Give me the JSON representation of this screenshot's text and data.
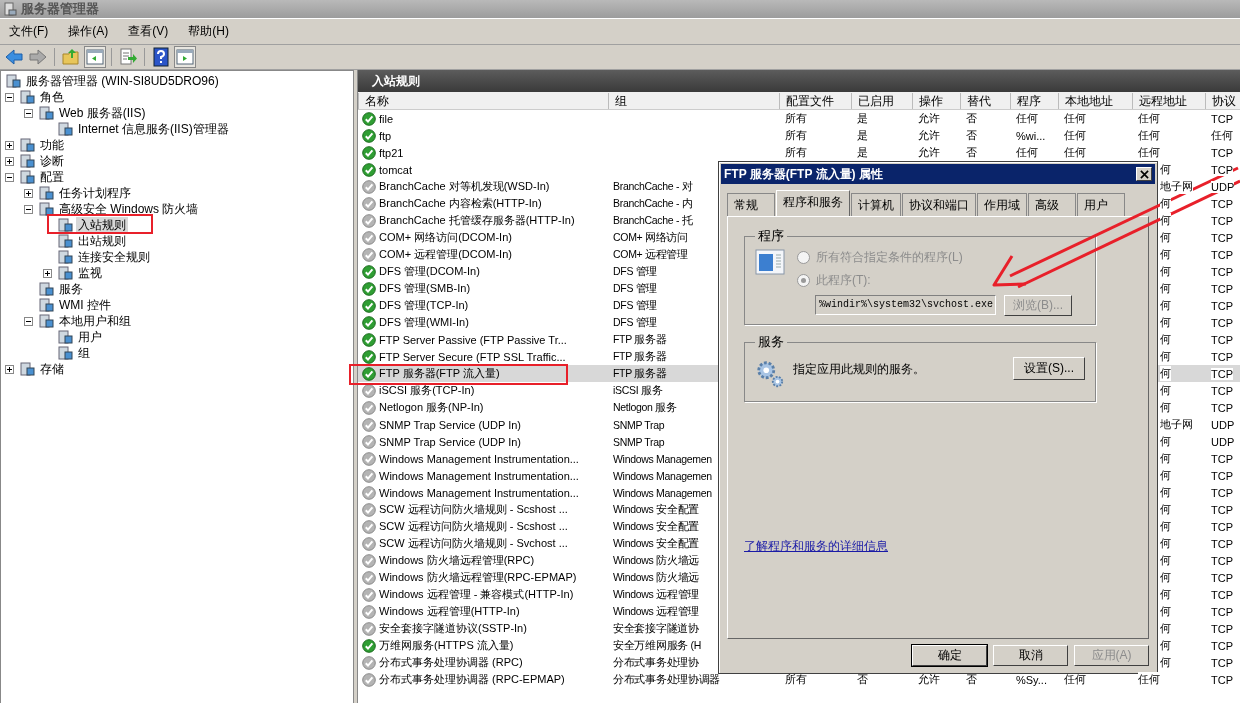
{
  "window": {
    "title": "服务器管理器"
  },
  "menu": [
    "文件(F)",
    "操作(A)",
    "查看(V)",
    "帮助(H)"
  ],
  "tree": {
    "label": "服务器管理器 (WIN-SI8UD5DRO96)",
    "selected": false,
    "children": [
      {
        "label": "角色",
        "selected": false,
        "expanded": true,
        "children": [
          {
            "label": "Web 服务器(IIS)",
            "selected": false,
            "expanded": true,
            "children": [
              {
                "label": "Internet 信息服务(IIS)管理器",
                "selected": false
              }
            ]
          }
        ]
      },
      {
        "label": "功能",
        "selected": false,
        "expanded": false
      },
      {
        "label": "诊断",
        "selected": false,
        "expanded": false
      },
      {
        "label": "配置",
        "selected": false,
        "expanded": true,
        "children": [
          {
            "label": "任务计划程序",
            "selected": false,
            "expanded": false
          },
          {
            "label": "高级安全 Windows 防火墙",
            "selected": false,
            "expanded": true,
            "children": [
              {
                "label": "入站规则",
                "selected": true
              },
              {
                "label": "出站规则",
                "selected": false
              },
              {
                "label": "连接安全规则",
                "selected": false
              },
              {
                "label": "监视",
                "selected": false,
                "expanded": false
              }
            ]
          },
          {
            "label": "服务",
            "selected": false
          },
          {
            "label": "WMI 控件",
            "selected": false
          },
          {
            "label": "本地用户和组",
            "selected": false,
            "expanded": true,
            "children": [
              {
                "label": "用户",
                "selected": false
              },
              {
                "label": "组",
                "selected": false
              }
            ]
          }
        ]
      },
      {
        "label": "存储",
        "selected": false,
        "expanded": false
      }
    ]
  },
  "pane": {
    "title": "入站规则",
    "columns": [
      "名称",
      "组",
      "配置文件",
      "已启用",
      "操作",
      "替代",
      "程序",
      "本地地址",
      "远程地址",
      "协议"
    ],
    "rows": [
      {
        "name": "file",
        "enabled": true,
        "selected": false,
        "profile": "所有",
        "on": "是",
        "action": "允许",
        "override": "否",
        "program": "任何",
        "local": "任何",
        "remote": "任何",
        "protocol": "TCP"
      },
      {
        "name": "ftp",
        "enabled": true,
        "selected": false,
        "profile": "所有",
        "on": "是",
        "action": "允许",
        "override": "否",
        "program": "%wi...",
        "local": "任何",
        "remote": "任何",
        "protocol": "任何"
      },
      {
        "name": "ftp21",
        "enabled": true,
        "selected": false,
        "profile": "所有",
        "on": "是",
        "action": "允许",
        "override": "否",
        "program": "任何",
        "local": "任何",
        "remote": "任何",
        "protocol": "TCP"
      },
      {
        "name": "tomcat",
        "enabled": true,
        "selected": false,
        "remote": "何",
        "protocol": "TCP"
      },
      {
        "name": "BranchCache 对等机发现(WSD-In)",
        "enabled": false,
        "selected": false,
        "group": "BranchCache - 对",
        "remote": "地子网",
        "protocol": "UDP"
      },
      {
        "name": "BranchCache 内容检索(HTTP-In)",
        "enabled": false,
        "selected": false,
        "group": "BranchCache - 内",
        "remote": "何",
        "protocol": "TCP"
      },
      {
        "name": "BranchCache 托管缓存服务器(HTTP-In)",
        "enabled": false,
        "selected": false,
        "group": "BranchCache - 托",
        "remote": "何",
        "protocol": "TCP"
      },
      {
        "name": "COM+ 网络访问(DCOM-In)",
        "enabled": false,
        "selected": false,
        "group": "COM+ 网络访问",
        "remote": "何",
        "protocol": "TCP"
      },
      {
        "name": "COM+ 远程管理(DCOM-In)",
        "enabled": false,
        "selected": false,
        "group": "COM+ 远程管理",
        "remote": "何",
        "protocol": "TCP"
      },
      {
        "name": "DFS 管理(DCOM-In)",
        "enabled": true,
        "selected": false,
        "group": "DFS 管理",
        "remote": "何",
        "protocol": "TCP"
      },
      {
        "name": "DFS 管理(SMB-In)",
        "enabled": true,
        "selected": false,
        "group": "DFS 管理",
        "remote": "何",
        "protocol": "TCP"
      },
      {
        "name": "DFS 管理(TCP-In)",
        "enabled": true,
        "selected": false,
        "group": "DFS 管理",
        "remote": "何",
        "protocol": "TCP"
      },
      {
        "name": "DFS 管理(WMI-In)",
        "enabled": true,
        "selected": false,
        "group": "DFS 管理",
        "remote": "何",
        "protocol": "TCP"
      },
      {
        "name": "FTP Server Passive (FTP Passive Tr...",
        "enabled": true,
        "selected": false,
        "group": "FTP 服务器",
        "remote": "何",
        "protocol": "TCP"
      },
      {
        "name": "FTP Server Secure (FTP SSL Traffic...",
        "enabled": true,
        "selected": false,
        "group": "FTP 服务器",
        "remote": "何",
        "protocol": "TCP"
      },
      {
        "name": "FTP 服务器(FTP 流入量)",
        "enabled": true,
        "selected": true,
        "group": "FTP 服务器",
        "remote": "何",
        "protocol": "TCP"
      },
      {
        "name": "iSCSI 服务(TCP-In)",
        "enabled": false,
        "selected": false,
        "group": "iSCSI 服务",
        "remote": "何",
        "protocol": "TCP"
      },
      {
        "name": "Netlogon 服务(NP-In)",
        "enabled": false,
        "selected": false,
        "group": "Netlogon 服务",
        "remote": "何",
        "protocol": "TCP"
      },
      {
        "name": "SNMP Trap Service (UDP In)",
        "enabled": false,
        "selected": false,
        "group": "SNMP Trap",
        "remote": "地子网",
        "protocol": "UDP"
      },
      {
        "name": "SNMP Trap Service (UDP In)",
        "enabled": false,
        "selected": false,
        "group": "SNMP Trap",
        "remote": "何",
        "protocol": "UDP"
      },
      {
        "name": "Windows Management Instrumentation...",
        "enabled": false,
        "selected": false,
        "group": "Windows Managemen",
        "remote": "何",
        "protocol": "TCP"
      },
      {
        "name": "Windows Management Instrumentation...",
        "enabled": false,
        "selected": false,
        "group": "Windows Managemen",
        "remote": "何",
        "protocol": "TCP"
      },
      {
        "name": "Windows Management Instrumentation...",
        "enabled": false,
        "selected": false,
        "group": "Windows Managemen",
        "remote": "何",
        "protocol": "TCP"
      },
      {
        "name": "SCW 远程访问防火墙规则 - Scshost ...",
        "enabled": false,
        "selected": false,
        "group": "Windows 安全配置",
        "remote": "何",
        "protocol": "TCP"
      },
      {
        "name": "SCW 远程访问防火墙规则 - Scshost ...",
        "enabled": false,
        "selected": false,
        "group": "Windows 安全配置",
        "remote": "何",
        "protocol": "TCP"
      },
      {
        "name": "SCW 远程访问防火墙规则 - Svchost ...",
        "enabled": false,
        "selected": false,
        "group": "Windows 安全配置",
        "remote": "何",
        "protocol": "TCP"
      },
      {
        "name": "Windows 防火墙远程管理(RPC)",
        "enabled": false,
        "selected": false,
        "group": "Windows 防火墙远",
        "remote": "何",
        "protocol": "TCP"
      },
      {
        "name": "Windows 防火墙远程管理(RPC-EPMAP)",
        "enabled": false,
        "selected": false,
        "group": "Windows 防火墙远",
        "remote": "何",
        "protocol": "TCP"
      },
      {
        "name": "Windows 远程管理 - 兼容模式(HTTP-In)",
        "enabled": false,
        "selected": false,
        "group": "Windows 远程管理",
        "remote": "何",
        "protocol": "TCP"
      },
      {
        "name": "Windows 远程管理(HTTP-In)",
        "enabled": false,
        "selected": false,
        "group": "Windows 远程管理",
        "remote": "何",
        "protocol": "TCP"
      },
      {
        "name": "安全套接字隧道协议(SSTP-In)",
        "enabled": false,
        "selected": false,
        "group": "安全套接字隧道协",
        "remote": "何",
        "protocol": "TCP"
      },
      {
        "name": "万维网服务(HTTPS 流入量)",
        "enabled": true,
        "selected": false,
        "group": "安全万维网服务 (H",
        "remote": "何",
        "protocol": "TCP"
      },
      {
        "name": "分布式事务处理协调器 (RPC)",
        "enabled": false,
        "selected": false,
        "group": "分布式事务处理协",
        "remote": "何",
        "protocol": "TCP"
      },
      {
        "name": "分布式事务处理协调器 (RPC-EPMAP)",
        "enabled": false,
        "selected": false,
        "group": "分布式事务处理协调器",
        "profile": "所有",
        "on": "否",
        "action": "允许",
        "override": "否",
        "program": "%Sy...",
        "local": "任何",
        "remote": "任何",
        "protocol": "TCP"
      }
    ]
  },
  "dialog": {
    "title": "FTP 服务器(FTP 流入量) 属性",
    "tabs": [
      {
        "label": "常规",
        "selected": false
      },
      {
        "label": "程序和服务",
        "selected": true
      },
      {
        "label": "计算机",
        "selected": false
      },
      {
        "label": "协议和端口",
        "selected": false
      },
      {
        "label": "作用域",
        "selected": false
      },
      {
        "label": "高级",
        "selected": false
      },
      {
        "label": "用户",
        "selected": false
      }
    ],
    "program_group": {
      "title": "程序",
      "options": [
        {
          "label": "所有符合指定条件的程序(L)",
          "checked": false,
          "disabled": true
        },
        {
          "label": "此程序(T):",
          "checked": true,
          "disabled": true
        }
      ],
      "path": "%windir%\\system32\\svchost.exe",
      "browse": {
        "label": "浏览(B)...",
        "disabled": true
      }
    },
    "service_group": {
      "title": "服务",
      "text": "指定应用此规则的服务。",
      "button": {
        "label": "设置(S)...",
        "disabled": false
      }
    },
    "link": "了解程序和服务的详细信息",
    "buttons": [
      {
        "label": "确定",
        "disabled": false
      },
      {
        "label": "取消",
        "disabled": false
      },
      {
        "label": "应用(A)",
        "disabled": true
      }
    ]
  }
}
